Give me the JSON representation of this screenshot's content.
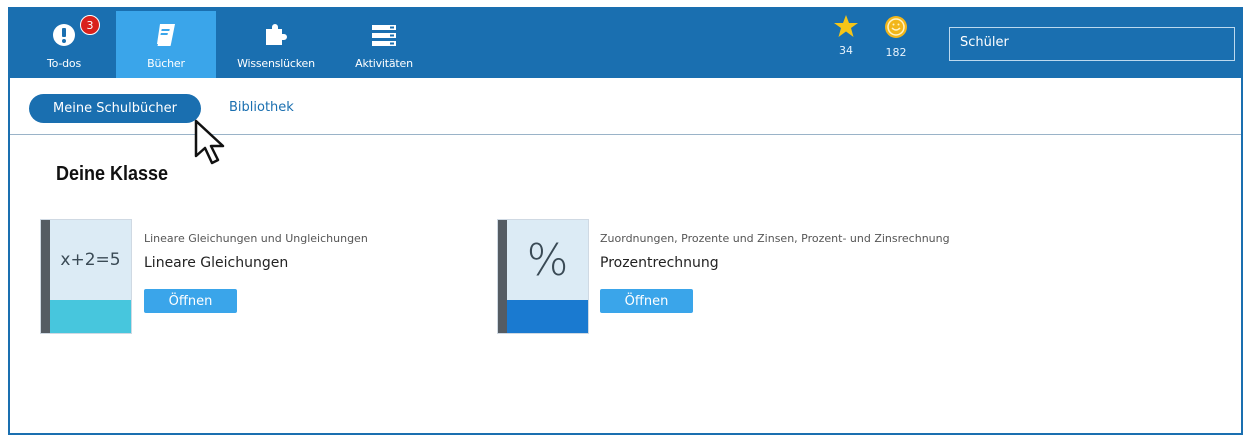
{
  "nav": {
    "todos": {
      "label": "To-dos",
      "badge": "3"
    },
    "books": {
      "label": "Bücher"
    },
    "gaps": {
      "label": "Wissenslücken"
    },
    "activities": {
      "label": "Aktivitäten"
    }
  },
  "stats": {
    "stars": "34",
    "coins": "182"
  },
  "user": {
    "name": "Schüler"
  },
  "subtabs": {
    "my_books": "Meine Schulbücher",
    "library": "Bibliothek"
  },
  "section": {
    "title": "Deine Klasse"
  },
  "books": [
    {
      "category": "Lineare Gleichungen und Ungleichungen",
      "name": "Lineare Gleichungen",
      "cover_text": "x+2=5",
      "open": "Öffnen",
      "cover_color": "#dcebf5",
      "bottom_color": "#47c6dd"
    },
    {
      "category": "Zuordnungen, Prozente und Zinsen, Prozent- und Zinsrechnung",
      "name": "Prozentrechnung",
      "cover_text": "%",
      "open": "Öffnen",
      "cover_color": "#dcebf5",
      "bottom_color": "#1a7ad0"
    }
  ],
  "colors": {
    "accent": "#1a6fb0",
    "active_tab": "#3aa5ea",
    "badge": "#d9211c"
  }
}
